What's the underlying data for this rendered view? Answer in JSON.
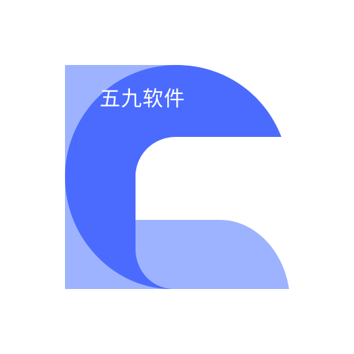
{
  "logo": {
    "text": "五九软件",
    "icon": "stylized-c-logo",
    "colors": {
      "primary": "#4B6BFF",
      "secondary": "#9DB3FF",
      "text": "#FFFFFF",
      "background": "#FFFFFF"
    }
  }
}
